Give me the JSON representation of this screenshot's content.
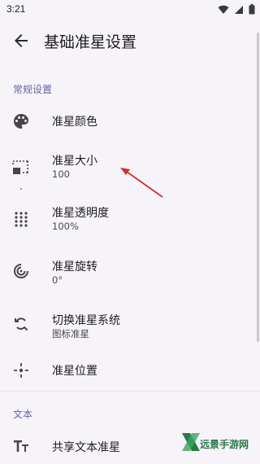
{
  "status_bar": {
    "time": "3:21"
  },
  "header": {
    "title": "基础准星设置"
  },
  "sections": [
    {
      "title": "常规设置",
      "items": [
        {
          "title": "准星颜色",
          "icon": "palette-icon"
        },
        {
          "title": "准星大小",
          "subtitle": "100",
          "icon": "crop-free-icon"
        },
        {
          "title": "准星透明度",
          "subtitle": "100%",
          "icon": "dot-grid-icon"
        },
        {
          "title": "准星旋转",
          "subtitle": "0°",
          "icon": "rotate-radar-icon"
        },
        {
          "title": "切换准星系统",
          "subtitle": "图标准星",
          "icon": "refresh-search-icon"
        },
        {
          "title": "准星位置",
          "icon": "crosshair-position-icon"
        }
      ]
    },
    {
      "title": "文本",
      "items": [
        {
          "title": "共享文本准星",
          "icon": "text-size-icon"
        }
      ]
    }
  ],
  "annotation": {
    "color": "#d32f2f"
  },
  "watermark": {
    "text": "远景手游网",
    "color": "#2a7a48"
  },
  "colors": {
    "accent": "#6a5fa9",
    "background": "#f6f4f8"
  }
}
